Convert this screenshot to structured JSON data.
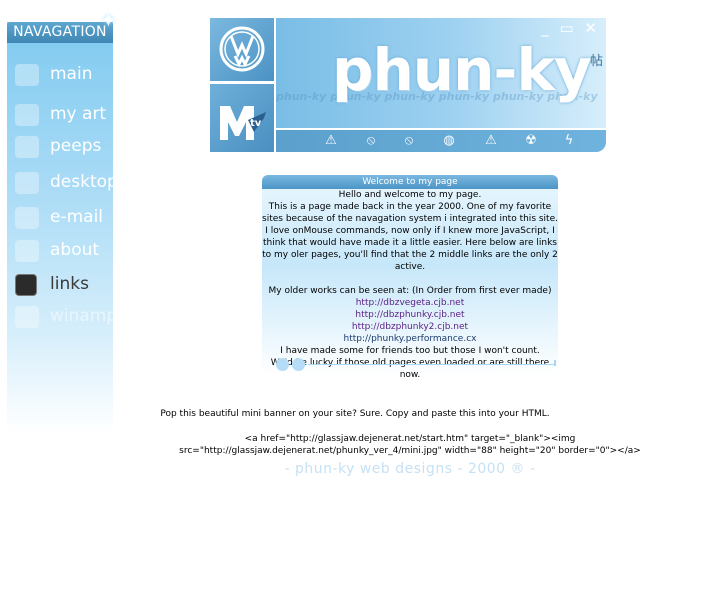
{
  "nav": {
    "title": "NAVAGATION",
    "items": [
      {
        "label": "main",
        "icon": "main-icon",
        "state": "normal"
      },
      {
        "label": "my art",
        "icon": "art-icon",
        "state": "normal"
      },
      {
        "label": "peeps",
        "icon": "folder-icon",
        "state": "normal"
      },
      {
        "label": "desktop",
        "icon": "desktop-icon",
        "state": "normal"
      },
      {
        "label": "e-mail",
        "icon": "email-icon",
        "state": "normal"
      },
      {
        "label": "about",
        "icon": "about-icon",
        "state": "normal"
      },
      {
        "label": "links",
        "icon": "links-icon",
        "state": "active"
      },
      {
        "label": "winamp",
        "icon": "winamp-icon",
        "state": "faded"
      }
    ]
  },
  "banner": {
    "title": "phun-ky",
    "bg_text": "phun-ky phun-ky phun-ky phun-ky phun-ky phun-ky",
    "win_controls": "_ ▭ ✕",
    "kanji": "帖",
    "logos": [
      "vw-logo",
      "mtv-logo"
    ],
    "symbols": [
      "warning-icon",
      "no-entry-icon",
      "no-entry-icon",
      "helmet-icon",
      "warning-icon",
      "radiation-icon",
      "lightning-icon"
    ]
  },
  "welcome": {
    "header": "Welcome to my page",
    "greeting": "Hello and welcome to my page.",
    "paragraph": "This is a page made back in the year 2000. One of my favorite sites because of the navagation system i integrated into this site. I love onMouse commands, now only if I knew more JavaScript, I think that would have made it a little easier. Here below are links to my oler pages, you'll find that the 2 middle links are the only 2 active.",
    "older_works": "My older works can be seen at: (In Order from first ever made)",
    "links": [
      "http://dbzvegeta.cjb.net",
      "http://dbzphunky.cjb.net",
      "http://dbzphunky2.cjb.net",
      "http://phunky.performance.cx"
    ],
    "friends": "I have made some for friends too but those I won't count.",
    "lucky": "We'd be lucky if those old pages even loaded or are still there now."
  },
  "banner_offer": "Pop this beautiful mini banner on your site? Sure. Copy and paste this into your HTML.",
  "code_snippet": "<a href=\"http://glassjaw.dejenerat.net/start.htm\" target=\"_blank\"><img src=\"http://glassjaw.dejenerat.net/phunky_ver_4/mini.jpg\" width=\"88\" height=\"20\" border=\"0\"></a>",
  "credits": "- phun-ky web designs - 2000 ® -",
  "colors": {
    "accent": "#4b92c4",
    "sidebar_top": "#7fcaf0",
    "link_purple": "#5a1f84",
    "link_navy": "#1c3b6e"
  }
}
